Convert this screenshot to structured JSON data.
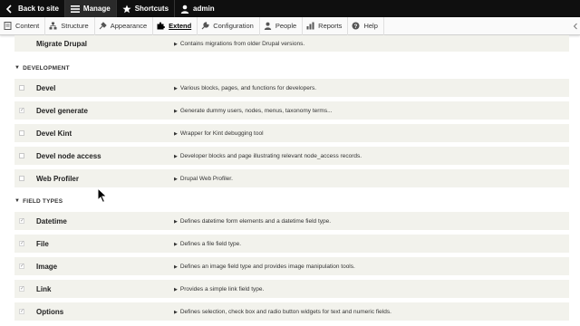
{
  "toolbar": {
    "back": "Back to site",
    "manage": "Manage",
    "shortcuts": "Shortcuts",
    "user": "admin"
  },
  "tray": {
    "items": [
      {
        "label": "Content",
        "icon": "content-icon"
      },
      {
        "label": "Structure",
        "icon": "structure-icon"
      },
      {
        "label": "Appearance",
        "icon": "appearance-icon"
      },
      {
        "label": "Extend",
        "icon": "extend-icon",
        "active": true
      },
      {
        "label": "Configuration",
        "icon": "wrench-icon"
      },
      {
        "label": "People",
        "icon": "people-icon"
      },
      {
        "label": "Reports",
        "icon": "reports-icon"
      },
      {
        "label": "Help",
        "icon": "help-icon"
      }
    ]
  },
  "modules": {
    "migrate": {
      "name": "Migrate Drupal",
      "desc": "Contains migrations from older Drupal versions."
    },
    "development": {
      "title": "DEVELOPMENT",
      "items": [
        {
          "name": "Devel",
          "desc": "Various blocks, pages, and functions for developers.",
          "checked": false
        },
        {
          "name": "Devel generate",
          "desc": "Generate dummy users, nodes, menus, taxonomy terms...",
          "checked": true
        },
        {
          "name": "Devel Kint",
          "desc": "Wrapper for Kint debugging tool",
          "checked": false
        },
        {
          "name": "Devel node access",
          "desc": "Developer blocks and page illustrating relevant node_access records.",
          "checked": false
        },
        {
          "name": "Web Profiler",
          "desc": "Drupal Web Profiler.",
          "checked": false
        }
      ]
    },
    "field_types": {
      "title": "FIELD TYPES",
      "items": [
        {
          "name": "Datetime",
          "desc": "Defines datetime form elements and a datetime field type.",
          "checked": true
        },
        {
          "name": "File",
          "desc": "Defines a file field type.",
          "checked": true
        },
        {
          "name": "Image",
          "desc": "Defines an image field type and provides image manipulation tools.",
          "checked": true
        },
        {
          "name": "Link",
          "desc": "Provides a simple link field type.",
          "checked": true
        },
        {
          "name": "Options",
          "desc": "Defines selection, check box and radio button widgets for text and numeric fields.",
          "checked": true
        }
      ]
    }
  },
  "colors": {
    "row_bg": "#f2f2ec",
    "toolbar_bg": "#0f0f0f"
  }
}
